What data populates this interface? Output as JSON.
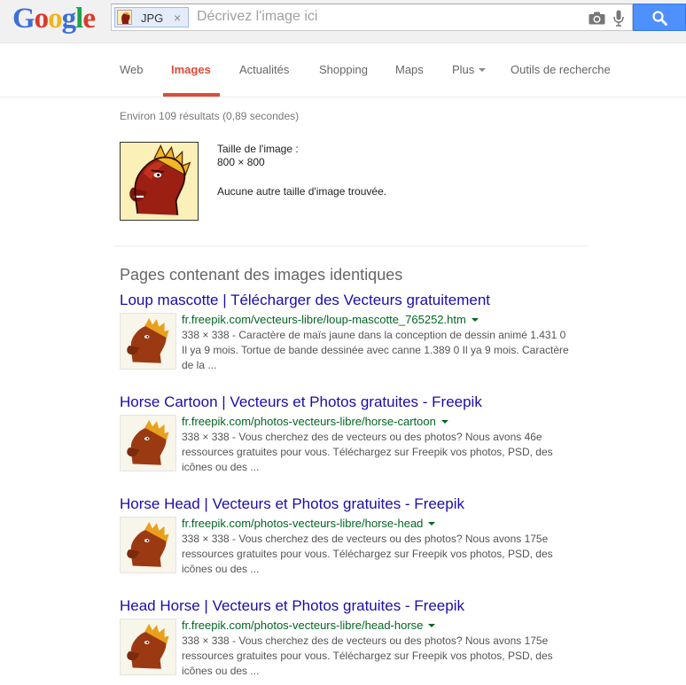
{
  "header": {
    "logo_letters": [
      "G",
      "o",
      "o",
      "g",
      "l",
      "e"
    ],
    "chip_label": "JPG",
    "chip_close": "×",
    "search_placeholder": "Décrivez l'image ici",
    "icons": [
      "camera-icon",
      "microphone-icon",
      "search-icon"
    ],
    "search_button_color": "#4d90fe"
  },
  "nav": {
    "tabs": [
      "Web",
      "Images",
      "Actualités",
      "Shopping",
      "Maps",
      "Plus",
      "Outils de recherche"
    ],
    "active_tab": "Images",
    "active_color": "#dd4b39"
  },
  "stats": "Environ 109 résultats (0,89 secondes)",
  "image_info": {
    "size_label": "Taille de l'image :",
    "size_value": "800 × 800",
    "no_other_sizes": "Aucune autre taille d'image trouvée."
  },
  "section_title": "Pages contenant des images identiques",
  "results": [
    {
      "title": "Loup mascotte | Télécharger des Vecteurs gratuitement",
      "url": "fr.freepik.com/vecteurs-libre/loup-mascotte_765252.htm",
      "snippet": "338 × 338 - Caractère de maïs jaune dans la conception de dessin animé 1.431 0 Il ya 9 mois. Tortue de bande dessinée avec canne 1.389 0 Il ya 9 mois. Caractère de la ..."
    },
    {
      "title": "Horse Cartoon | Vecteurs et Photos gratuites - Freepik",
      "url": "fr.freepik.com/photos-vecteurs-libre/horse-cartoon",
      "snippet": "338 × 338 - Vous cherchez des de vecteurs ou des photos? Nous avons 46e ressources gratuites pour vous. Téléchargez sur Freepik vos photos, PSD, des icônes ou des ..."
    },
    {
      "title": "Horse Head | Vecteurs et Photos gratuites - Freepik",
      "url": "fr.freepik.com/photos-vecteurs-libre/horse-head",
      "snippet": "338 × 338 - Vous cherchez des de vecteurs ou des photos? Nous avons 175e ressources gratuites pour vous. Téléchargez sur Freepik vos photos, PSD, des icônes ou des ..."
    },
    {
      "title": "Head Horse | Vecteurs et Photos gratuites - Freepik",
      "url": "fr.freepik.com/photos-vecteurs-libre/head-horse",
      "snippet": "338 × 338 - Vous cherchez des de vecteurs ou des photos? Nous avons 175e ressources gratuites pour vous. Téléchargez sur Freepik vos photos, PSD, des icônes ou des ..."
    }
  ]
}
